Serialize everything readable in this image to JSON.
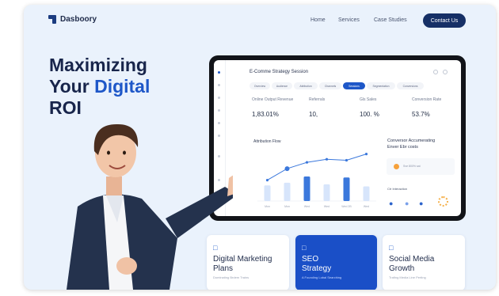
{
  "header": {
    "logo_text": "Dasboory",
    "nav": [
      "Home",
      "Services",
      "Case Studies"
    ],
    "contact_label": "Contact Us"
  },
  "hero": {
    "line1": "Maximizing",
    "line2_a": "Your ",
    "line2_b": "Digital",
    "line3": "ROI"
  },
  "dashboard": {
    "title": "E-Comme Strategy Session",
    "tabs": [
      "Overview",
      "Audience",
      "Attribution",
      "Channels",
      "Sessions",
      "Segmentation",
      "Conversions"
    ],
    "active_tab": 4,
    "kpis": [
      {
        "label": "Online Output Revenue",
        "value": "1,83.01%"
      },
      {
        "label": "Referrals",
        "value": "10,"
      },
      {
        "label": "Gls Sales",
        "value": "100. %"
      },
      {
        "label": "Conversion Rate",
        "value": "53.7%"
      }
    ],
    "chart_title": "Attribution Flow",
    "right_panel": {
      "title_line1": "Conversor Accumerating",
      "title_line2": "Enver Ebr costs",
      "box_text": "Sve 800% sat",
      "section": "Ctr Interaction"
    },
    "chart_data": {
      "type": "bar",
      "categories": [
        "Mon",
        "Mon",
        "Wed",
        "Wed",
        "Wed 2B",
        "Wed"
      ],
      "series": [
        {
          "values": [
            30,
            35,
            47,
            32,
            45,
            28
          ]
        }
      ],
      "line_values": [
        40,
        62,
        74,
        80,
        78,
        90
      ]
    }
  },
  "cards": [
    {
      "icon": "chart-icon",
      "title_line1": "Digital Marketing",
      "title_line2": "Plans",
      "sub": "Dominating Brdem Trains"
    },
    {
      "icon": "seo-icon",
      "title_line1": "SEO",
      "title_line2": "Strategy",
      "sub": "A Founding Lobal Searching"
    },
    {
      "icon": "social-icon",
      "title_line1": "Social Media",
      "title_line2": "Growth",
      "sub": "Trafing Media Line Perting"
    }
  ],
  "colors": {
    "accent": "#1e57c8",
    "dark": "#163066",
    "bg": "#eaf2fc"
  }
}
